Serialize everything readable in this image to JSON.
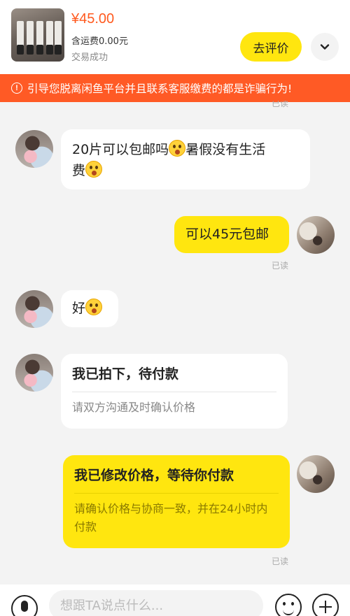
{
  "header": {
    "price": "¥45.00",
    "shipping": "含运费0.00元",
    "status": "交易成功",
    "review_button": "去评价",
    "expand_icon": "chevron-down-icon"
  },
  "warning": {
    "text": "引导您脱离闲鱼平台并且联系客服缴费的都是诈骗行为!",
    "icon": "alert-circle-icon"
  },
  "messages": [
    {
      "from": "other",
      "text_a": "20片可以包邮吗",
      "text_b": "暑假没有生活",
      "text_c": "费",
      "emojis": [
        "flushed-emoji",
        "crying-emoji"
      ]
    },
    {
      "from": "self",
      "text": "可以45元包邮",
      "read": "已读"
    },
    {
      "from": "other",
      "text": "好",
      "emojis": [
        "flushed-emoji"
      ]
    },
    {
      "from": "other",
      "type": "card",
      "title": "我已拍下，待付款",
      "body": "请双方沟通及时确认价格"
    },
    {
      "from": "self",
      "type": "card",
      "title": "我已修改价格，等待你付款",
      "body": "请确认价格与协商一致，并在24小时内付款",
      "read": "已读"
    }
  ],
  "read_top": "已读",
  "input_bar": {
    "placeholder": "想跟TA说点什么...",
    "icons": [
      "mic-icon",
      "emoji-icon",
      "plus-icon"
    ]
  },
  "colors": {
    "accent_yellow": "#ffe60f",
    "warning_orange": "#ff5a25",
    "price_orange": "#ff5a1f"
  }
}
